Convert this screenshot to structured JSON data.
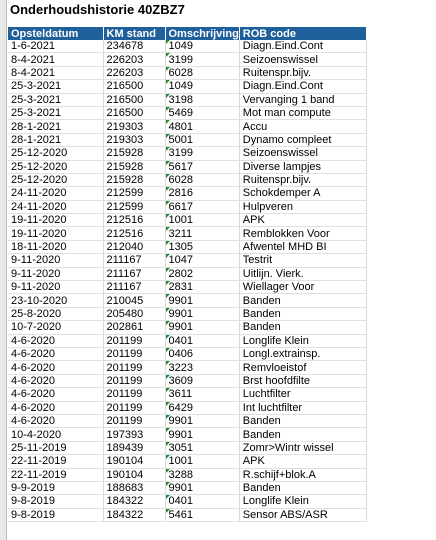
{
  "sheet": {
    "title": "Onderhoudshistorie 40ZBZ7",
    "columns": [
      "Opsteldatum",
      "KM stand",
      "Omschrijving",
      "ROB code"
    ],
    "rows": [
      [
        "1-6-2021",
        "234678",
        "1049",
        "Diagn.Eind.Cont"
      ],
      [
        "8-4-2021",
        "226203",
        "3199",
        "Seizoenswissel"
      ],
      [
        "8-4-2021",
        "226203",
        "6028",
        "Ruitenspr.bijv."
      ],
      [
        "25-3-2021",
        "216500",
        "1049",
        "Diagn.Eind.Cont"
      ],
      [
        "25-3-2021",
        "216500",
        "3198",
        "Vervanging 1 band"
      ],
      [
        "25-3-2021",
        "216500",
        "5469",
        "Mot man compute"
      ],
      [
        "28-1-2021",
        "219303",
        "4801",
        "Accu"
      ],
      [
        "28-1-2021",
        "219303",
        "5001",
        "Dynamo compleet"
      ],
      [
        "25-12-2020",
        "215928",
        "3199",
        "Seizoenswissel"
      ],
      [
        "25-12-2020",
        "215928",
        "5617",
        "Diverse lampjes"
      ],
      [
        "25-12-2020",
        "215928",
        "6028",
        "Ruitenspr.bijv."
      ],
      [
        "24-11-2020",
        "212599",
        "2816",
        "Schokdemper A"
      ],
      [
        "24-11-2020",
        "212599",
        "6617",
        "Hulpveren"
      ],
      [
        "19-11-2020",
        "212516",
        "1001",
        "APK"
      ],
      [
        "19-11-2020",
        "212516",
        "3211",
        "Remblokken Voor"
      ],
      [
        "18-11-2020",
        "212040",
        "1305",
        "Afwentel MHD BI"
      ],
      [
        "9-11-2020",
        "211167",
        "1047",
        "Testrit"
      ],
      [
        "9-11-2020",
        "211167",
        "2802",
        "Uitlijn. Vierk."
      ],
      [
        "9-11-2020",
        "211167",
        "2831",
        "Wiellager Voor"
      ],
      [
        "23-10-2020",
        "210045",
        "9901",
        "Banden"
      ],
      [
        "25-8-2020",
        "205480",
        "9901",
        "Banden"
      ],
      [
        "10-7-2020",
        "202861",
        "9901",
        "Banden"
      ],
      [
        "4-6-2020",
        "201199",
        "0401",
        "Longlife Klein"
      ],
      [
        "4-6-2020",
        "201199",
        "0406",
        "Longl.extrainsp."
      ],
      [
        "4-6-2020",
        "201199",
        "3223",
        "Remvloeistof"
      ],
      [
        "4-6-2020",
        "201199",
        "3609",
        "Brst hoofdfilte"
      ],
      [
        "4-6-2020",
        "201199",
        "3611",
        "Luchtfilter"
      ],
      [
        "4-6-2020",
        "201199",
        "6429",
        "Int luchtfilter"
      ],
      [
        "4-6-2020",
        "201199",
        "9901",
        "Banden"
      ],
      [
        "10-4-2020",
        "197393",
        "9901",
        "Banden"
      ],
      [
        "25-11-2019",
        "189439",
        "3051",
        "Zomr>Wintr wissel"
      ],
      [
        "22-11-2019",
        "190104",
        "1001",
        "APK"
      ],
      [
        "22-11-2019",
        "190104",
        "3288",
        "R.schijf+blok.A"
      ],
      [
        "9-9-2019",
        "188683",
        "9901",
        "Banden"
      ],
      [
        "9-8-2019",
        "184322",
        "0401",
        "Longlife Klein"
      ],
      [
        "9-8-2019",
        "184322",
        "5461",
        "Sensor ABS/ASR"
      ]
    ]
  }
}
